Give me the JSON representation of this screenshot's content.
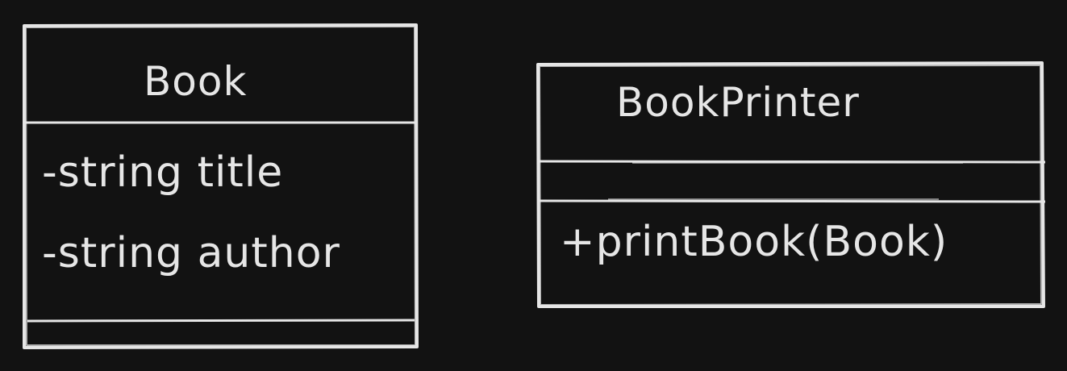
{
  "diagram": {
    "classes": [
      {
        "name": "Book",
        "attributes": [
          "-string title",
          "-string author"
        ],
        "methods": []
      },
      {
        "name": "BookPrinter",
        "attributes": [],
        "methods": [
          "+printBook(Book)"
        ]
      }
    ],
    "colors": {
      "background": "#121212",
      "stroke": "#e6e6e6"
    }
  }
}
